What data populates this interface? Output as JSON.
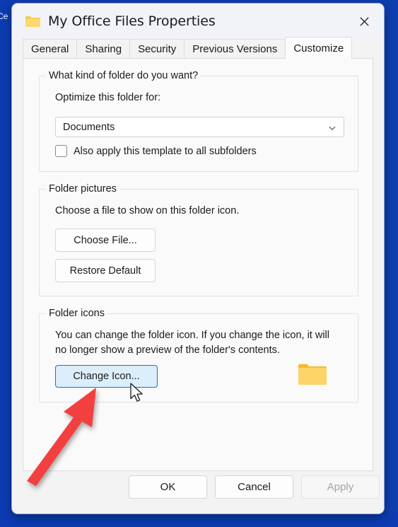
{
  "window": {
    "title": "My Office Files Properties",
    "title_icon": "folder-icon",
    "close_icon": "close-icon"
  },
  "backdrop": {
    "fragment_text": "Ce",
    "color": "#103db0"
  },
  "tabs": [
    {
      "label": "General",
      "active": false
    },
    {
      "label": "Sharing",
      "active": false
    },
    {
      "label": "Security",
      "active": false
    },
    {
      "label": "Previous Versions",
      "active": false
    },
    {
      "label": "Customize",
      "active": true
    }
  ],
  "groups": {
    "folder_kind": {
      "title": "What kind of folder do you want?",
      "optimize_label": "Optimize this folder for:",
      "combo": {
        "value": "Documents",
        "chevron_icon": "chevron-down-icon"
      },
      "checkbox": {
        "label": "Also apply this template to all subfolders",
        "checked": false
      }
    },
    "folder_pictures": {
      "title": "Folder pictures",
      "description": "Choose a file to show on this folder icon.",
      "choose_file_label": "Choose File...",
      "restore_default_label": "Restore Default"
    },
    "folder_icons": {
      "title": "Folder icons",
      "description": "You can change the folder icon. If you change the icon, it will no longer show a preview of the folder's contents.",
      "change_icon_label": "Change Icon...",
      "preview_icon": "folder-icon"
    }
  },
  "buttonbar": {
    "ok_label": "OK",
    "cancel_label": "Cancel",
    "apply_label": "Apply",
    "apply_enabled": false
  },
  "annotations": {
    "arrow_color": "#f2413f",
    "arrow_target": "change-icon-button",
    "cursor_icon": "mouse-pointer-icon"
  },
  "colors": {
    "accent": "#0078d4",
    "highlight_fill": "#dceefb",
    "highlight_border": "#1a73c4",
    "folder_yellow": "#fcc93f",
    "dialog_bg": "#f3f3f3",
    "panel_bg": "#fafafa"
  }
}
